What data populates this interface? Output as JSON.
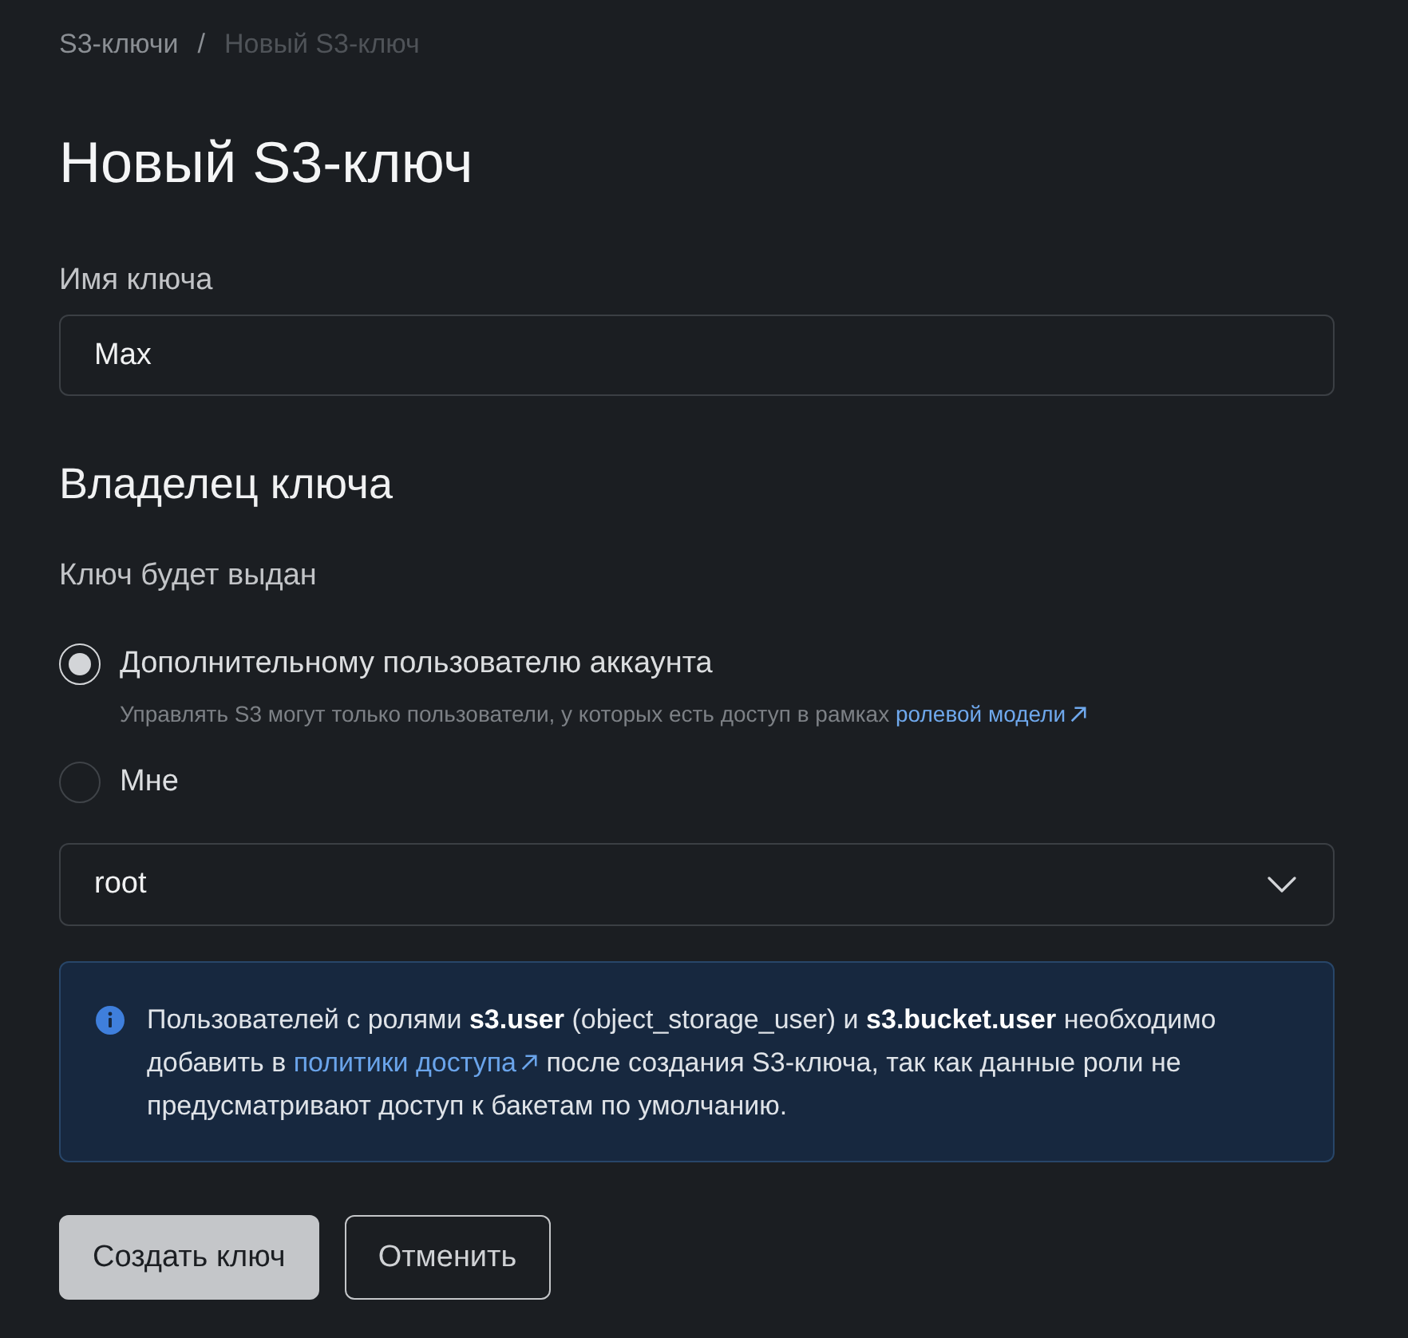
{
  "breadcrumbs": {
    "items": [
      {
        "label": "S3-ключи",
        "current": false
      },
      {
        "label": "Новый S3-ключ",
        "current": true
      }
    ],
    "separator": "/"
  },
  "title": "Новый S3-ключ",
  "key_name": {
    "label": "Имя ключа",
    "value": "Max"
  },
  "owner": {
    "heading": "Владелец ключа",
    "label": "Ключ будет выдан",
    "options": [
      {
        "label": "Дополнительному пользователю аккаунта",
        "selected": true,
        "hint": "Управлять S3 могут только пользователи, у которых есть доступ в рамках",
        "hint_link": "ролевой модели"
      },
      {
        "label": "Мне",
        "selected": false
      }
    ],
    "user_select": {
      "value": "root"
    }
  },
  "info": {
    "text_before": "Пользователей с ролями **s3.user** (object_storage_user) и **s3.bucket.user** необходимо добавить в",
    "link": "политики доступа",
    "text_after": "после создания S3-ключа, так как данные роли не предусматривают доступ к бакетам по умолчанию."
  },
  "buttons": [
    {
      "label": "Создать ключ",
      "kind": "primary"
    },
    {
      "label": "Отменить",
      "kind": "secondary"
    }
  ]
}
